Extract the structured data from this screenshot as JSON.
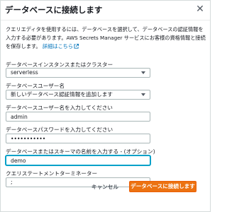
{
  "dialog": {
    "title": "データベースに接続します",
    "description": "クエリエディタを使用するには、データベースを選択して、データベースの認証情報を入力する必要があります。AWS Secrets Manager サービスにお客様の資格情報と接続を保存します。",
    "details_link": "詳細はこちら"
  },
  "form": {
    "cluster": {
      "label": "データベースインスタンスまたはクラスター",
      "value": "serverless"
    },
    "db_user": {
      "label": "データベースユーザー名",
      "value": "新しいデータベース認証情報を追加します"
    },
    "username": {
      "label": "データベースユーザー名を入力してください",
      "value": "admin"
    },
    "password": {
      "label": "データベースパスワードを入力してください",
      "value": "•••••••••••"
    },
    "database": {
      "label": "データベースまたはスキーマの名前を入力する - (オプション)",
      "value": "demo"
    },
    "terminator": {
      "label": "クエリステートメントターミネーター",
      "value": ";"
    }
  },
  "footer": {
    "cancel_label": "キャンセル",
    "connect_label": "データベースに接続します"
  },
  "colors": {
    "primary": "#ec7211",
    "link": "#0073bb",
    "focus": "#00a1c9"
  }
}
